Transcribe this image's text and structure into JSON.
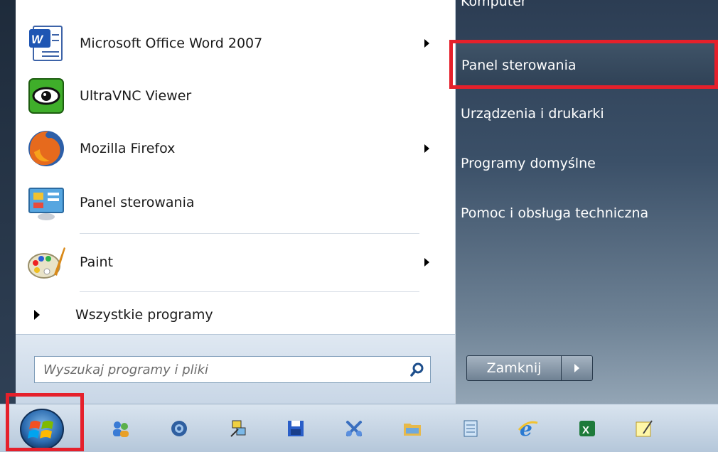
{
  "programs": [
    {
      "label": "Microsoft Office Word 2007",
      "icon": "word-icon",
      "has_submenu": true
    },
    {
      "label": "UltraVNC Viewer",
      "icon": "ultravnc-icon",
      "has_submenu": false
    },
    {
      "label": "Mozilla Firefox",
      "icon": "firefox-icon",
      "has_submenu": true
    },
    {
      "label": "Panel sterowania",
      "icon": "control-panel-icon",
      "has_submenu": false
    },
    {
      "label": "Paint",
      "icon": "paint-icon",
      "has_submenu": true
    }
  ],
  "all_programs_label": "Wszystkie programy",
  "search": {
    "placeholder": "Wyszukaj programy i pliki",
    "icon": "search-icon"
  },
  "right_items": [
    {
      "label": "Komputer"
    },
    {
      "label": "Panel sterowania",
      "selected": true
    },
    {
      "label": "Urządzenia i drukarki"
    },
    {
      "label": "Programy domyślne"
    },
    {
      "label": "Pomoc i obsługa techniczna"
    }
  ],
  "shutdown": {
    "label": "Zamknij",
    "arrow_icon": "chevron-right-icon"
  },
  "taskbar": {
    "start_icon": "windows-start-icon",
    "pinned": [
      "people-icon",
      "browser-globe-icon",
      "network-tool-icon",
      "save-disk-icon",
      "snipping-tool-icon",
      "file-explorer-icon",
      "notepad-icon",
      "internet-explorer-icon",
      "excel-icon",
      "sticky-notes-icon"
    ]
  },
  "colors": {
    "highlight_frame": "#e5202b",
    "right_pane": "#3b5068"
  }
}
